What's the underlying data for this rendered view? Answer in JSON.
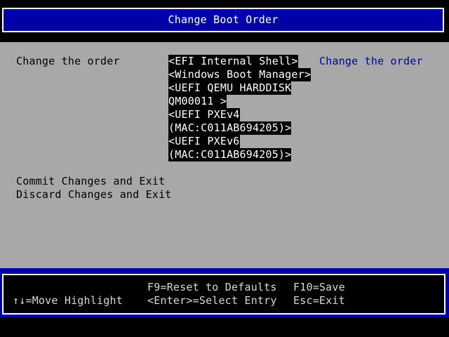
{
  "title": "Change Boot Order",
  "main": {
    "prompt_label": "Change the order",
    "boot_entries": [
      "<EFI Internal Shell>",
      "<Windows Boot Manager>",
      "<UEFI QEMU HARDDISK",
      "QM00011 >",
      "<UEFI PXEv4",
      "(MAC:C011AB694205)>",
      "<UEFI PXEv6",
      "(MAC:C011AB694205)>"
    ],
    "help_text": "Change the order",
    "commit_label": "Commit Changes and Exit",
    "discard_label": "Discard Changes and Exit"
  },
  "footer": {
    "move_highlight": "↑↓=Move Highlight",
    "reset_defaults": "F9=Reset to Defaults",
    "select_entry": "<Enter>=Select Entry",
    "save": "F10=Save",
    "exit": "Esc=Exit"
  },
  "colors": {
    "background_gray": "#a8a8a8",
    "title_blue": "#0000a8",
    "help_blue": "#0000a8",
    "highlight_black": "#000000",
    "text_white": "#ffffff"
  }
}
